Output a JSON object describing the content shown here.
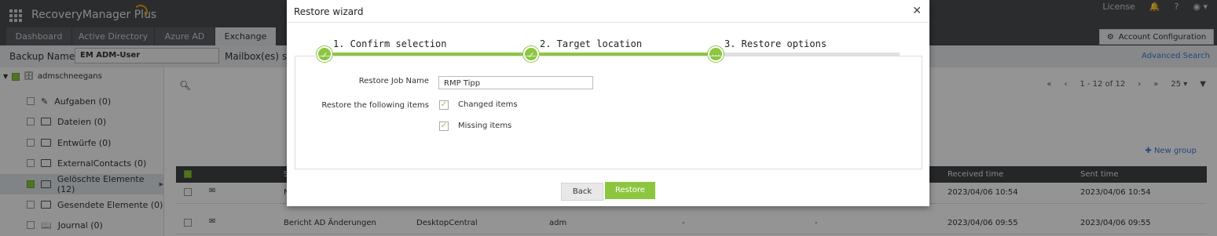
{
  "app": {
    "title": "RecoveryManager Plus",
    "license": "License",
    "help": "?"
  },
  "tabs": [
    {
      "label": "Dashboard"
    },
    {
      "label": "Active Directory"
    },
    {
      "label": "Azure AD"
    },
    {
      "label": "Exchange"
    }
  ],
  "account_config": "Account Configuration",
  "backup": {
    "label": "Backup Name",
    "value": "EM ADM-User",
    "mailbox_label": "Mailbox(es) sn",
    "advanced_search": "Advanced Search"
  },
  "tree": {
    "root": "admschneegans",
    "items": [
      {
        "label": "Aufgaben (0)"
      },
      {
        "label": "Dateien (0)"
      },
      {
        "label": "Entwürfe (0)"
      },
      {
        "label": "ExternalContacts (0)"
      },
      {
        "label": "Gelöschte Elemente (12)"
      },
      {
        "label": "Gesendete Elemente (0)"
      },
      {
        "label": "Journal (0)"
      }
    ]
  },
  "pager": {
    "range": "1 - 12 of 12",
    "page_size": "25"
  },
  "new_group": "New group",
  "table": {
    "col_subject": "S",
    "col_received": "Received time",
    "col_sent": "Sent time",
    "rows": [
      {
        "subject": "N",
        "from": "",
        "to": "",
        "c1": "",
        "c2": "",
        "received": "2023/04/06 10:54",
        "sent": "2023/04/06 10:54"
      },
      {
        "subject": "Bericht AD Änderungen",
        "from": "DesktopCentral",
        "to": "adm",
        "c1": "-",
        "c2": "-",
        "received": "2023/04/06 09:55",
        "sent": "2023/04/06 09:55"
      }
    ]
  },
  "wizard": {
    "title": "Restore wizard",
    "steps": [
      {
        "label": "1. Confirm selection"
      },
      {
        "label": "2. Target location"
      },
      {
        "label": "3. Restore options"
      }
    ],
    "job_name_label": "Restore Job Name",
    "job_name_value": "RMP Tipp",
    "restore_items_label": "Restore the following items",
    "opt_changed": "Changed items",
    "opt_missing": "Missing items",
    "back": "Back",
    "restore": "Restore"
  },
  "colors": {
    "accent": "#8cc63f",
    "header": "#4a4d50",
    "link": "#3a7bd5"
  }
}
